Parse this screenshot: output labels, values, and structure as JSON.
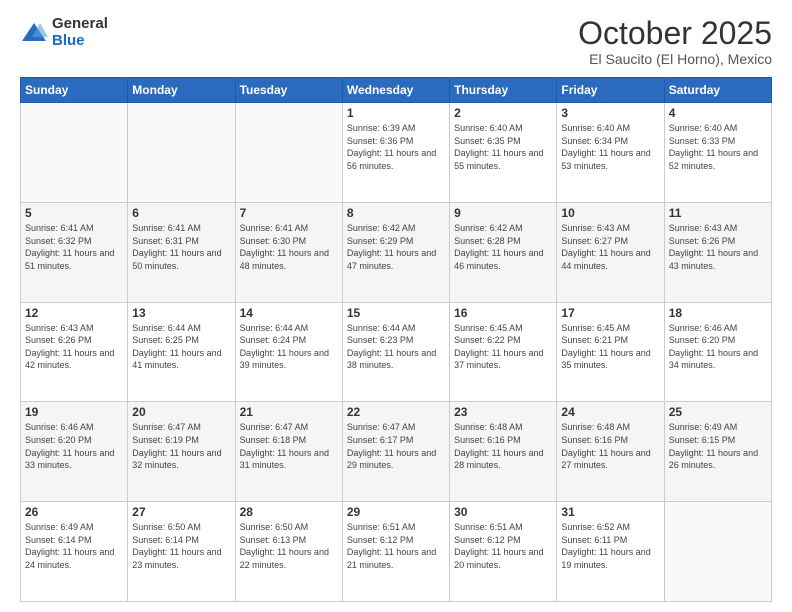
{
  "logo": {
    "general": "General",
    "blue": "Blue"
  },
  "title": "October 2025",
  "location": "El Saucito (El Horno), Mexico",
  "days_of_week": [
    "Sunday",
    "Monday",
    "Tuesday",
    "Wednesday",
    "Thursday",
    "Friday",
    "Saturday"
  ],
  "weeks": [
    [
      {
        "day": "",
        "sunrise": "",
        "sunset": "",
        "daylight": ""
      },
      {
        "day": "",
        "sunrise": "",
        "sunset": "",
        "daylight": ""
      },
      {
        "day": "",
        "sunrise": "",
        "sunset": "",
        "daylight": ""
      },
      {
        "day": "1",
        "sunrise": "Sunrise: 6:39 AM",
        "sunset": "Sunset: 6:36 PM",
        "daylight": "Daylight: 11 hours and 56 minutes."
      },
      {
        "day": "2",
        "sunrise": "Sunrise: 6:40 AM",
        "sunset": "Sunset: 6:35 PM",
        "daylight": "Daylight: 11 hours and 55 minutes."
      },
      {
        "day": "3",
        "sunrise": "Sunrise: 6:40 AM",
        "sunset": "Sunset: 6:34 PM",
        "daylight": "Daylight: 11 hours and 53 minutes."
      },
      {
        "day": "4",
        "sunrise": "Sunrise: 6:40 AM",
        "sunset": "Sunset: 6:33 PM",
        "daylight": "Daylight: 11 hours and 52 minutes."
      }
    ],
    [
      {
        "day": "5",
        "sunrise": "Sunrise: 6:41 AM",
        "sunset": "Sunset: 6:32 PM",
        "daylight": "Daylight: 11 hours and 51 minutes."
      },
      {
        "day": "6",
        "sunrise": "Sunrise: 6:41 AM",
        "sunset": "Sunset: 6:31 PM",
        "daylight": "Daylight: 11 hours and 50 minutes."
      },
      {
        "day": "7",
        "sunrise": "Sunrise: 6:41 AM",
        "sunset": "Sunset: 6:30 PM",
        "daylight": "Daylight: 11 hours and 48 minutes."
      },
      {
        "day": "8",
        "sunrise": "Sunrise: 6:42 AM",
        "sunset": "Sunset: 6:29 PM",
        "daylight": "Daylight: 11 hours and 47 minutes."
      },
      {
        "day": "9",
        "sunrise": "Sunrise: 6:42 AM",
        "sunset": "Sunset: 6:28 PM",
        "daylight": "Daylight: 11 hours and 46 minutes."
      },
      {
        "day": "10",
        "sunrise": "Sunrise: 6:43 AM",
        "sunset": "Sunset: 6:27 PM",
        "daylight": "Daylight: 11 hours and 44 minutes."
      },
      {
        "day": "11",
        "sunrise": "Sunrise: 6:43 AM",
        "sunset": "Sunset: 6:26 PM",
        "daylight": "Daylight: 11 hours and 43 minutes."
      }
    ],
    [
      {
        "day": "12",
        "sunrise": "Sunrise: 6:43 AM",
        "sunset": "Sunset: 6:26 PM",
        "daylight": "Daylight: 11 hours and 42 minutes."
      },
      {
        "day": "13",
        "sunrise": "Sunrise: 6:44 AM",
        "sunset": "Sunset: 6:25 PM",
        "daylight": "Daylight: 11 hours and 41 minutes."
      },
      {
        "day": "14",
        "sunrise": "Sunrise: 6:44 AM",
        "sunset": "Sunset: 6:24 PM",
        "daylight": "Daylight: 11 hours and 39 minutes."
      },
      {
        "day": "15",
        "sunrise": "Sunrise: 6:44 AM",
        "sunset": "Sunset: 6:23 PM",
        "daylight": "Daylight: 11 hours and 38 minutes."
      },
      {
        "day": "16",
        "sunrise": "Sunrise: 6:45 AM",
        "sunset": "Sunset: 6:22 PM",
        "daylight": "Daylight: 11 hours and 37 minutes."
      },
      {
        "day": "17",
        "sunrise": "Sunrise: 6:45 AM",
        "sunset": "Sunset: 6:21 PM",
        "daylight": "Daylight: 11 hours and 35 minutes."
      },
      {
        "day": "18",
        "sunrise": "Sunrise: 6:46 AM",
        "sunset": "Sunset: 6:20 PM",
        "daylight": "Daylight: 11 hours and 34 minutes."
      }
    ],
    [
      {
        "day": "19",
        "sunrise": "Sunrise: 6:46 AM",
        "sunset": "Sunset: 6:20 PM",
        "daylight": "Daylight: 11 hours and 33 minutes."
      },
      {
        "day": "20",
        "sunrise": "Sunrise: 6:47 AM",
        "sunset": "Sunset: 6:19 PM",
        "daylight": "Daylight: 11 hours and 32 minutes."
      },
      {
        "day": "21",
        "sunrise": "Sunrise: 6:47 AM",
        "sunset": "Sunset: 6:18 PM",
        "daylight": "Daylight: 11 hours and 31 minutes."
      },
      {
        "day": "22",
        "sunrise": "Sunrise: 6:47 AM",
        "sunset": "Sunset: 6:17 PM",
        "daylight": "Daylight: 11 hours and 29 minutes."
      },
      {
        "day": "23",
        "sunrise": "Sunrise: 6:48 AM",
        "sunset": "Sunset: 6:16 PM",
        "daylight": "Daylight: 11 hours and 28 minutes."
      },
      {
        "day": "24",
        "sunrise": "Sunrise: 6:48 AM",
        "sunset": "Sunset: 6:16 PM",
        "daylight": "Daylight: 11 hours and 27 minutes."
      },
      {
        "day": "25",
        "sunrise": "Sunrise: 6:49 AM",
        "sunset": "Sunset: 6:15 PM",
        "daylight": "Daylight: 11 hours and 26 minutes."
      }
    ],
    [
      {
        "day": "26",
        "sunrise": "Sunrise: 6:49 AM",
        "sunset": "Sunset: 6:14 PM",
        "daylight": "Daylight: 11 hours and 24 minutes."
      },
      {
        "day": "27",
        "sunrise": "Sunrise: 6:50 AM",
        "sunset": "Sunset: 6:14 PM",
        "daylight": "Daylight: 11 hours and 23 minutes."
      },
      {
        "day": "28",
        "sunrise": "Sunrise: 6:50 AM",
        "sunset": "Sunset: 6:13 PM",
        "daylight": "Daylight: 11 hours and 22 minutes."
      },
      {
        "day": "29",
        "sunrise": "Sunrise: 6:51 AM",
        "sunset": "Sunset: 6:12 PM",
        "daylight": "Daylight: 11 hours and 21 minutes."
      },
      {
        "day": "30",
        "sunrise": "Sunrise: 6:51 AM",
        "sunset": "Sunset: 6:12 PM",
        "daylight": "Daylight: 11 hours and 20 minutes."
      },
      {
        "day": "31",
        "sunrise": "Sunrise: 6:52 AM",
        "sunset": "Sunset: 6:11 PM",
        "daylight": "Daylight: 11 hours and 19 minutes."
      },
      {
        "day": "",
        "sunrise": "",
        "sunset": "",
        "daylight": ""
      }
    ]
  ]
}
